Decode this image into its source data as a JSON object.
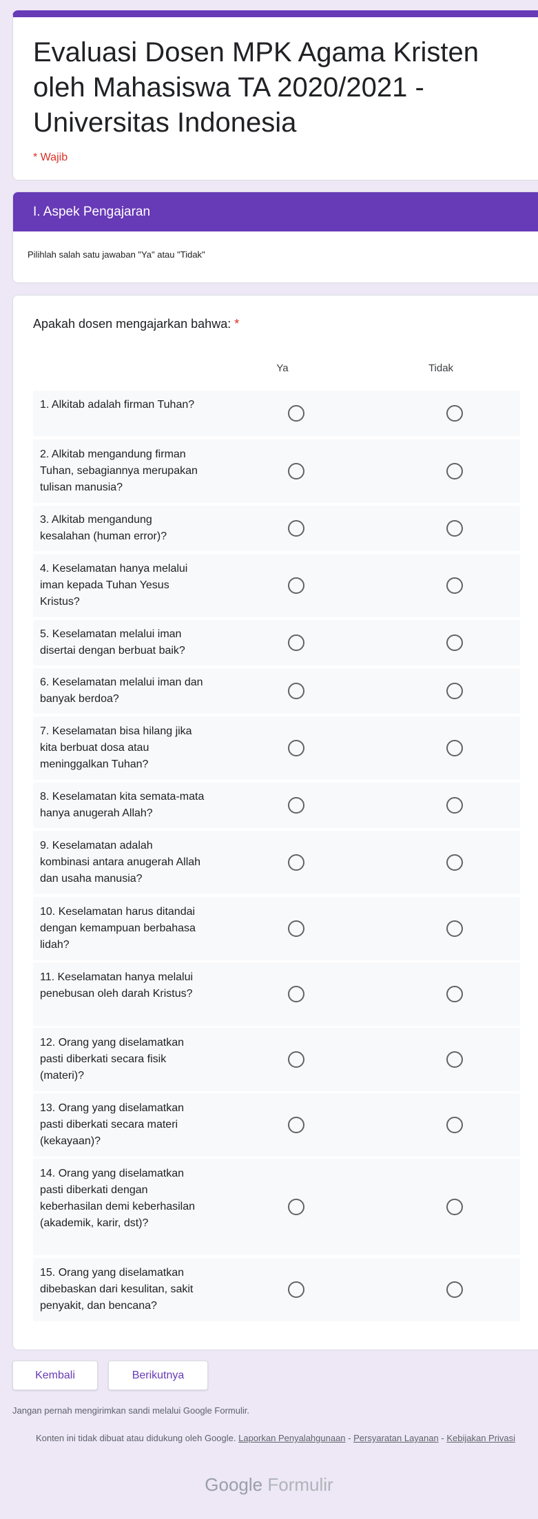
{
  "form": {
    "title": "Evaluasi Dosen MPK Agama Kristen oleh Mahasiswa TA 2020/2021 - Universitas Indonesia",
    "required_note": "* Wajib"
  },
  "section": {
    "title": "I. Aspek Pengajaran",
    "description": "Pilihlah salah satu jawaban \"Ya\" atau \"Tidak\""
  },
  "question": {
    "title": "Apakah dosen mengajarkan bahwa:",
    "required_marker": "*",
    "columns": [
      "Ya",
      "Tidak"
    ],
    "rows": [
      {
        "label": "1. Alkitab adalah firman Tuhan?"
      },
      {
        "label": "2. Alkitab mengandung firman Tuhan, sebagiannya merupakan tulisan manusia?"
      },
      {
        "label": "3. Alkitab mengandung kesalahan (human error)?"
      },
      {
        "label": "4. Keselamatan hanya melalui iman kepada Tuhan Yesus Kristus?"
      },
      {
        "label": "5. Keselamatan melalui iman disertai dengan berbuat baik?"
      },
      {
        "label": "6. Keselamatan melalui iman dan banyak berdoa?"
      },
      {
        "label": "7. Keselamatan bisa hilang jika kita berbuat dosa atau meninggalkan Tuhan?"
      },
      {
        "label": "8. Keselamatan kita semata-mata hanya anugerah Allah?"
      },
      {
        "label": "9. Keselamatan adalah kombinasi antara anugerah Allah dan usaha manusia?"
      },
      {
        "label": "10. Keselamatan harus ditandai dengan kemampuan berbahasa lidah?"
      },
      {
        "label": "11. Keselamatan hanya melalui penebusan oleh darah Kristus?"
      },
      {
        "label": "12. Orang yang diselamatkan pasti diberkati secara fisik (materi)?"
      },
      {
        "label": "13. Orang yang diselamatkan pasti diberkati secara materi (kekayaan)?"
      },
      {
        "label": "14. Orang yang diselamatkan pasti diberkati dengan keberhasilan demi keberhasilan (akademik, karir, dst)?"
      },
      {
        "label": "15. Orang yang diselamatkan dibebaskan dari kesulitan, sakit penyakit, dan bencana?"
      }
    ]
  },
  "buttons": {
    "back": "Kembali",
    "next": "Berikutnya"
  },
  "footer": {
    "warning": "Jangan pernah mengirimkan sandi melalui Google Formulir.",
    "disclaimer": "Konten ini tidak dibuat atau didukung oleh Google.",
    "link_abuse": "Laporkan Penyalahgunaan",
    "link_terms": "Persyaratan Layanan",
    "link_privacy": "Kebijakan Privasi",
    "separator": "-",
    "brand_google": "Google",
    "brand_forms": "Formulir"
  },
  "colors": {
    "accent": "#673ab7",
    "required": "#d93025",
    "background": "#ede7f6"
  }
}
